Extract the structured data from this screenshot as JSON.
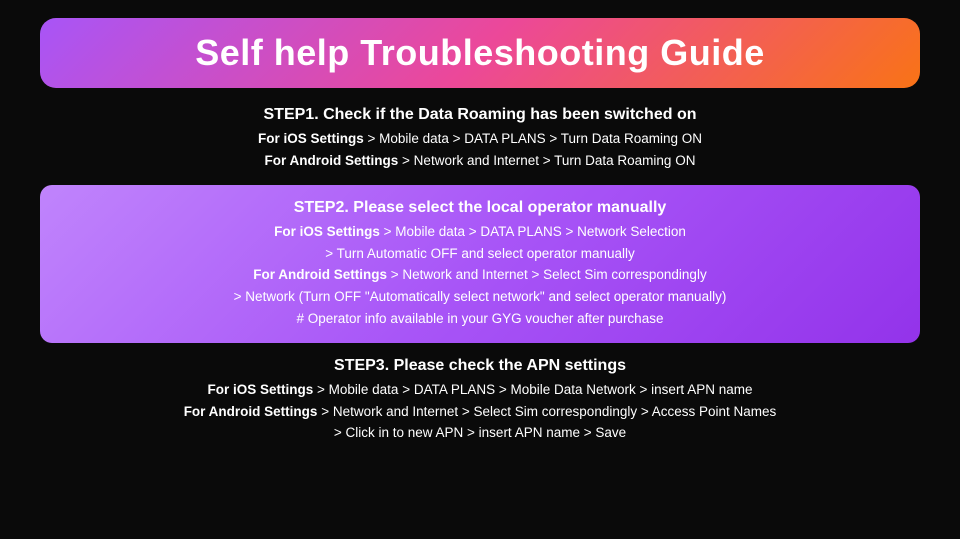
{
  "title": "Self help Troubleshooting Guide",
  "step1": {
    "title": "STEP1. Check if the Data Roaming has been switched on",
    "line1_bold": "For iOS Settings",
    "line1_rest": " > Mobile data > DATA PLANS > Turn Data Roaming ON",
    "line2_bold": "For Android Settings",
    "line2_rest": " > Network and Internet > Turn Data Roaming ON"
  },
  "step2": {
    "title": "STEP2. Please select the local operator manually",
    "line1_bold": "For iOS Settings",
    "line1_rest": " > Mobile data > DATA PLANS > Network Selection",
    "line2": "> Turn Automatic OFF and select operator manually",
    "line3_bold": "For Android Settings",
    "line3_rest": " > Network and Internet > Select Sim correspondingly",
    "line4": "> Network (Turn OFF \"Automatically select network\" and select operator manually)",
    "line5": "# Operator info available in your GYG voucher after purchase"
  },
  "step3": {
    "title": "STEP3. Please check the APN settings",
    "line1_bold": "For iOS Settings",
    "line1_rest": " > Mobile data > DATA PLANS > Mobile Data Network > insert APN name",
    "line2_bold": "For Android Settings",
    "line2_rest": " > Network and Internet > Select Sim correspondingly > Access Point Names",
    "line3": "> Click in to new APN > insert APN name > Save"
  }
}
